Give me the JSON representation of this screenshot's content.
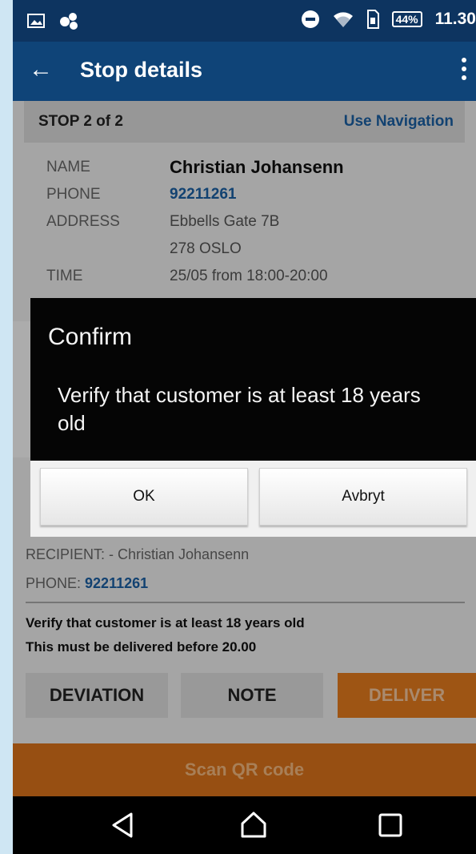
{
  "status_bar": {
    "battery": "44%",
    "time": "11.30",
    "icons": [
      "image-icon",
      "app-icon",
      "do-not-disturb-icon",
      "wifi-icon",
      "sim-icon",
      "battery-icon"
    ]
  },
  "app_bar": {
    "title": "Stop details",
    "back_icon": "arrow-back-icon",
    "menu_icon": "more-vert-icon"
  },
  "stop": {
    "label": "STOP 2 of 2",
    "navigation_link": "Use Navigation"
  },
  "customer": {
    "name_label": "NAME",
    "name": "Christian Johansenn",
    "phone_label": "PHONE",
    "phone": "92211261",
    "address_label": "ADDRESS",
    "address_line1": "Ebbells Gate 7B",
    "address_line2": "278 OSLO",
    "time_label": "TIME",
    "time": "25/05 from 18:00-20:00"
  },
  "delivery": {
    "recipient": "RECIPIENT: - Christian Johansenn",
    "phone_label": "PHONE:",
    "phone": "92211261",
    "note1": "Verify that customer is at least 18 years old",
    "note2": "This must be delivered before 20.00"
  },
  "actions": {
    "deviation": "DEVIATION",
    "note": "NOTE",
    "deliver": "DELIVER"
  },
  "scan": {
    "label": "Scan QR code"
  },
  "dialog": {
    "title": "Confirm",
    "message": "Verify that customer is at least 18 years old",
    "ok": "OK",
    "cancel": "Avbryt"
  },
  "colors": {
    "status_bar": "#0d3460",
    "app_bar": "#0f4478",
    "accent_orange": "#e27a1d",
    "link_blue": "#1a5fa3"
  }
}
